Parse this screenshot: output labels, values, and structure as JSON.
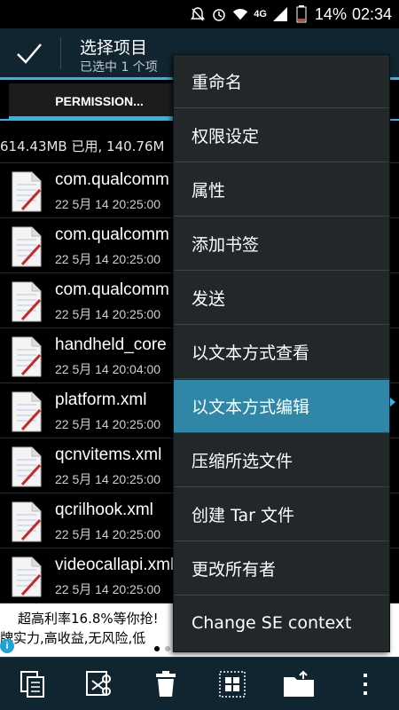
{
  "status_bar": {
    "network": "4G",
    "battery": "14%",
    "time": "02:34"
  },
  "action_bar": {
    "title": "选择项目",
    "subtitle": "已选中 1 个项"
  },
  "tabs": [
    {
      "label": "PERMISSION..."
    }
  ],
  "storage": {
    "text": "614.43MB 已用, 140.76M"
  },
  "files": [
    {
      "name": "com.qualcomm",
      "meta": "22 5月 14 20:25:00",
      "icon": "text-file-icon"
    },
    {
      "name": "com.qualcomm",
      "meta": "22 5月 14 20:25:00",
      "icon": "text-file-icon"
    },
    {
      "name": "com.qualcomm",
      "meta": "22 5月 14 20:25:00",
      "icon": "text-file-icon"
    },
    {
      "name": "handheld_core",
      "meta": "22 5月 14 20:04:00",
      "icon": "text-file-icon"
    },
    {
      "name": "platform.xml",
      "meta": "22 5月 14 20:25:00",
      "icon": "text-file-icon"
    },
    {
      "name": "qcnvitems.xml",
      "meta": "22 5月 14 20:25:00",
      "icon": "text-file-icon"
    },
    {
      "name": "qcrilhook.xml",
      "meta": "22 5月 14 20:25:00",
      "icon": "text-file-icon"
    },
    {
      "name": "videocallapi.xml",
      "meta": "22 5月 14 20:25:00",
      "icon": "text-file-icon"
    }
  ],
  "ad": {
    "line1": "超高利率16.8%等你抢!",
    "line2": "牌实力,高收益,无风险,低",
    "info": "i"
  },
  "menu": {
    "items": [
      {
        "label": "重命名"
      },
      {
        "label": "权限设定"
      },
      {
        "label": "属性"
      },
      {
        "label": "添加书签"
      },
      {
        "label": "发送"
      },
      {
        "label": "以文本方式查看"
      },
      {
        "label": "以文本方式编辑",
        "active": true
      },
      {
        "label": "压缩所选文件"
      },
      {
        "label": "创建 Tar 文件"
      },
      {
        "label": "更改所有者"
      },
      {
        "label": "Change SE context"
      }
    ]
  },
  "bottom_bar": {
    "buttons": [
      "copy-icon",
      "cut-icon",
      "delete-icon",
      "select-all-icon",
      "move-folder-icon",
      "overflow-menu-icon"
    ]
  },
  "colors": {
    "accent": "#33b5e5",
    "action_bar": "#10252f",
    "menu_bg": "#222829",
    "menu_active": "#2f86a6"
  }
}
